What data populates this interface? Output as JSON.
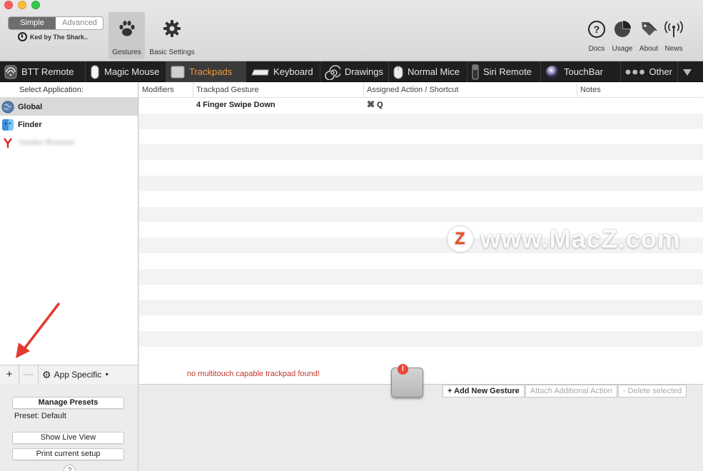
{
  "toolbar": {
    "mode_simple": "Simple",
    "mode_advanced": "Advanced",
    "credit": "Ked by The Shark..",
    "gestures_label": "Gestures",
    "basic_settings_label": "Basic Settings",
    "docs_label": "Docs",
    "usage_label": "Usage",
    "about_label": "About",
    "news_label": "News"
  },
  "tabs": [
    {
      "label": "BTT Remote"
    },
    {
      "label": "Magic Mouse"
    },
    {
      "label": "Trackpads"
    },
    {
      "label": "Keyboard"
    },
    {
      "label": "Drawings"
    },
    {
      "label": "Normal Mice"
    },
    {
      "label": "Siri Remote"
    },
    {
      "label": "TouchBar"
    },
    {
      "label": "Other"
    }
  ],
  "sidebar": {
    "header": "Select Application:",
    "apps": [
      {
        "name": "Global"
      },
      {
        "name": "Finder"
      },
      {
        "name": "Yandex Browser"
      }
    ],
    "add": "+",
    "remove": "—",
    "app_specific": "App Specific"
  },
  "table": {
    "columns": [
      "Modifiers",
      "Trackpad Gesture",
      "Assigned Action / Shortcut",
      "Notes"
    ],
    "rows": [
      {
        "modifiers": "",
        "gesture": "4 Finger Swipe Down",
        "action": "⌘ Q",
        "notes": ""
      }
    ]
  },
  "status": {
    "warning": "no multitouch capable trackpad found!",
    "badge": "!"
  },
  "actions": {
    "add": "+ Add New Gesture",
    "attach": "Attach Additional Action",
    "delete": "- Delete selected"
  },
  "presets": {
    "manage": "Manage Presets",
    "current": "Preset: Default",
    "live_view": "Show Live View",
    "print": "Print current setup",
    "help": "?"
  },
  "watermark": {
    "logo": "Z",
    "text": "www.MacZ.com"
  },
  "colors": {
    "active_tab": "#f29a3b",
    "warning": "#c0392b",
    "selection": "#d9d9d9"
  }
}
